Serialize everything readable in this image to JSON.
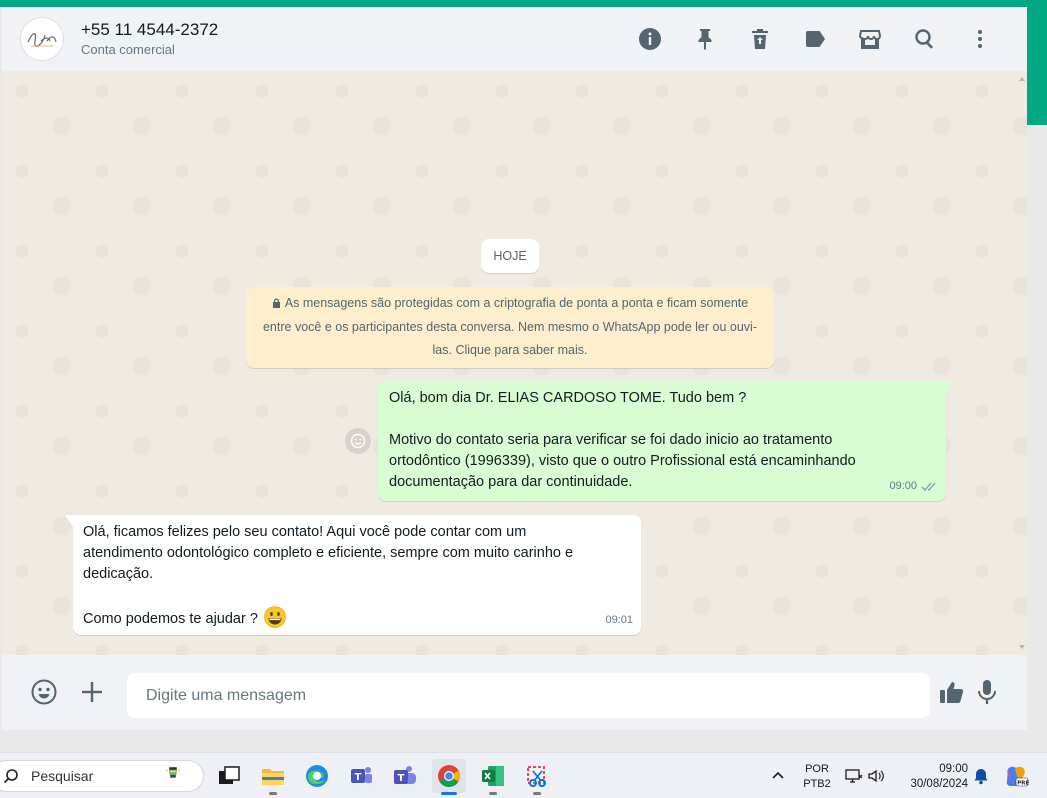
{
  "header": {
    "contact_name": "+55 11 4544-2372",
    "contact_subtitle": "Conta comercial",
    "icons": [
      "info-icon",
      "pin-icon",
      "delete-icon",
      "label-icon",
      "store-icon",
      "search-icon",
      "menu-icon"
    ]
  },
  "chat": {
    "date_label": "HOJE",
    "encryption_notice": "As mensagens são protegidas com a criptografia de ponta a ponta e ficam somente entre você e os participantes desta conversa. Nem mesmo o WhatsApp pode ler ou ouvi-las. Clique para saber mais.",
    "outgoing": {
      "line1": "Olá, bom dia Dr. ELIAS CARDOSO TOME. Tudo bem ?",
      "line2": "Motivo do contato seria para verificar se foi dado inicio ao tratamento ortodôntico (1996339), visto que o outro Profissional está encaminhando documentação para dar continuidade.",
      "time": "09:00",
      "status": "read"
    },
    "incoming": {
      "line1": "Olá, ficamos felizes pelo seu contato! Aqui você pode contar com um atendimento odontológico completo e eficiente, sempre com muito carinho e dedicação.",
      "line2": "Como podemos te ajudar ?",
      "time": "09:01"
    }
  },
  "composer": {
    "placeholder": "Digite uma mensagem",
    "value": ""
  },
  "taskbar": {
    "search_label": "Pesquisar",
    "lang_line1": "POR",
    "lang_line2": "PTB2",
    "time": "09:00",
    "date": "30/08/2024"
  },
  "colors": {
    "accent": "#00a884",
    "outgoing_bubble": "#d9fdd3",
    "incoming_bubble": "#ffffff",
    "encryption_bg": "#ffeecd",
    "read_ticks": "#8696a0"
  }
}
